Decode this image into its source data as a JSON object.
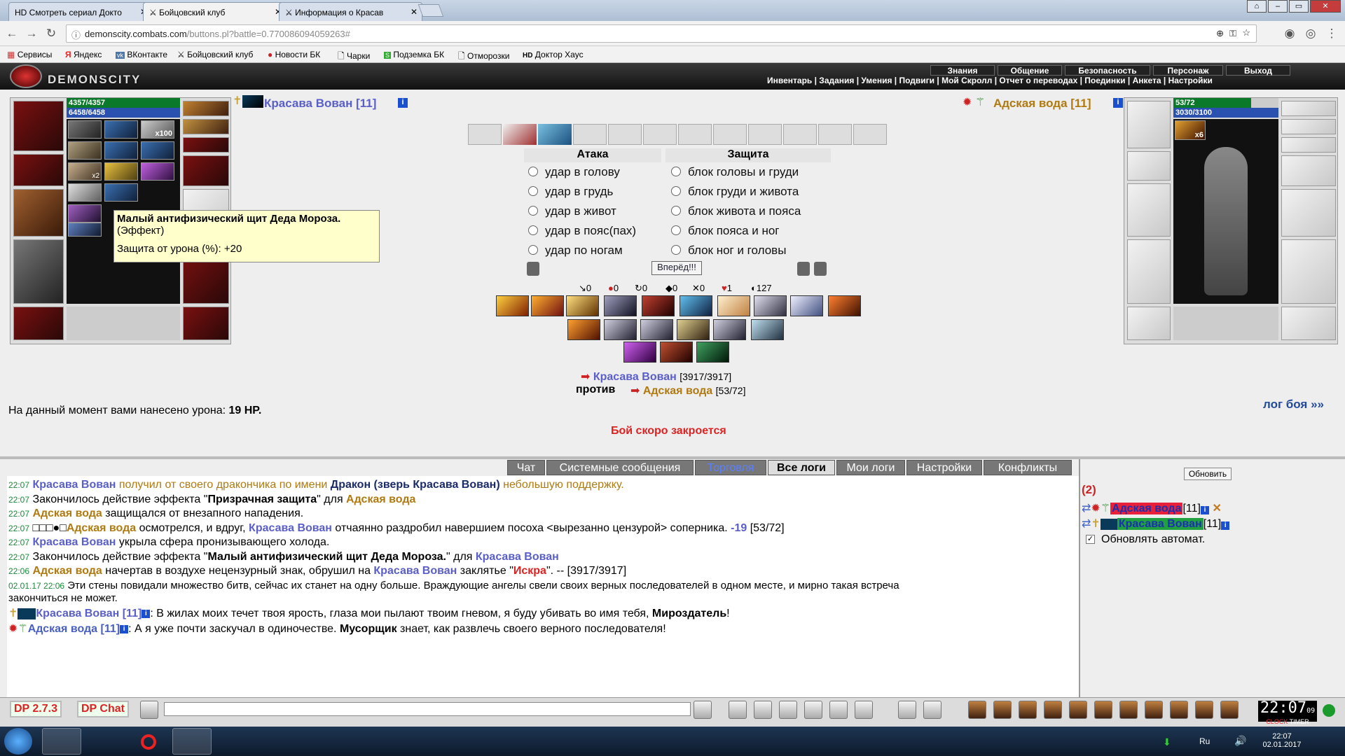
{
  "browser": {
    "tabs": [
      {
        "label": "HD Смотреть сериал Докто"
      },
      {
        "label": "Бойцовский клуб"
      },
      {
        "label": "Информация о Красав"
      }
    ],
    "url_host": "demonscity.combats.com",
    "url_path": "/buttons.pl?battle=0.770086094059263#",
    "bookmarks": [
      "Сервисы",
      "Яндекс",
      "ВКонтакте",
      "Бойцовский клуб",
      "Новости БК",
      "Чарки",
      "Подземка БК",
      "Отморозки",
      "Доктор Хаус"
    ]
  },
  "site": {
    "logo": "DEMONSCITY",
    "top_menu": [
      "Знания",
      "Общение",
      "Безопасность",
      "Персонаж",
      "Выход"
    ],
    "sub_menu": "Инвентарь | Задания | Умения | Подвиги | Мой Скролл | Отчет о переводах | Поединки | Анкета | Настройки"
  },
  "player": {
    "name": "Красава Вован [11]",
    "hp": "4357/4357",
    "mana": "6458/6458",
    "badge_x100": "x100",
    "badge_x2": "x2"
  },
  "enemy": {
    "name": "Адская вода [11]",
    "hp": "53/72",
    "mana": "3030/3100",
    "badge_x6": "x6"
  },
  "battle": {
    "attack_title": "Атака",
    "defense_title": "Защита",
    "attacks": [
      "удар в голову",
      "удар в грудь",
      "удар в живот",
      "удар в пояс(пах)",
      "удар по ногам"
    ],
    "defenses": [
      "блок головы и груди",
      "блок груди и живота",
      "блок живота и пояса",
      "блок пояса и ног",
      "блок ног и головы"
    ],
    "go_button": "Вперёд!!!",
    "counters": [
      "0",
      "0",
      "0",
      "0",
      "0",
      "1",
      "127"
    ],
    "vs_player": "Красава Вован",
    "vs_player_hp": "[3917/3917]",
    "vs_word": "против",
    "vs_enemy": "Адская вода",
    "vs_enemy_hp": "[53/72]",
    "damage_prefix": "На данный момент вами нанесено урона: ",
    "damage_value": "19 HP.",
    "closing": "Бой скоро закроется",
    "log_link": "лог боя »»"
  },
  "tooltip": {
    "title": "Малый антифизический щит Деда Мороза.",
    "sub": "(Эффект)",
    "detail": "Защита от урона (%): +20"
  },
  "chat_tabs": [
    "Чат",
    "Системные сообщения",
    "Торговля",
    "Все логи",
    "Мои логи",
    "Настройки",
    "Конфликты"
  ],
  "chat_lines": [
    {
      "t": "22:07",
      "parts": [
        {
          "s": "Красава Вован",
          "c": "blue",
          "b": true
        },
        {
          "s": " получил от своего дракончика по имени ",
          "c": "gold"
        },
        {
          "s": "Дракон (зверь Красава Вован)",
          "c": "dark",
          "b": true
        },
        {
          "s": " небольшую поддержку.",
          "c": "gold"
        }
      ]
    },
    {
      "t": "22:07",
      "parts": [
        {
          "s": "Закончилось действие эффекта \""
        },
        {
          "s": "Призрачная защита",
          "b": true
        },
        {
          "s": "\" для "
        },
        {
          "s": "Адская вода",
          "c": "gold",
          "b": true
        }
      ]
    },
    {
      "t": "22:07",
      "parts": [
        {
          "s": "Адская вода",
          "c": "gold",
          "b": true
        },
        {
          "s": " защищался от внезапного нападения."
        }
      ]
    },
    {
      "t": "22:07",
      "parts": [
        {
          "s": "□□□●□"
        },
        {
          "s": "Адская вода",
          "c": "gold",
          "b": true
        },
        {
          "s": " осмотрелся, и вдруг, "
        },
        {
          "s": "Красава Вован",
          "c": "blue",
          "b": true
        },
        {
          "s": " отчаянно раздробил навершием посоха <вырезанно цензурой> соперника. "
        },
        {
          "s": "-19",
          "c": "blue",
          "b": true
        },
        {
          "s": " [53/72]"
        }
      ]
    },
    {
      "t": "22:07",
      "parts": [
        {
          "s": "Красава Вован",
          "c": "blue",
          "b": true
        },
        {
          "s": " укрыла сфера пронизывающего холода."
        }
      ]
    },
    {
      "t": "22:07",
      "parts": [
        {
          "s": "Закончилось действие эффекта \""
        },
        {
          "s": "Малый антифизический щит Деда Мороза.",
          "b": true
        },
        {
          "s": "\" для "
        },
        {
          "s": "Красава Вован",
          "c": "blue",
          "b": true
        }
      ]
    },
    {
      "t": "22:06",
      "parts": [
        {
          "s": "Адская вода",
          "c": "gold",
          "b": true
        },
        {
          "s": " начертав в воздухе нецензурный знак, обрушил на "
        },
        {
          "s": "Красава Вован",
          "c": "blue",
          "b": true
        },
        {
          "s": " заклятье \""
        },
        {
          "s": "Искра",
          "c": "red",
          "b": true
        },
        {
          "s": "\". -- [3917/3917]"
        }
      ]
    }
  ],
  "chat_intro_time": "02.01.17 22:06",
  "chat_intro": "Эти стены повидали множество битв, сейчас их станет на одну больше. Враждующие ангелы свели своих верных последователей в одном месте, и мирно такая встреча",
  "chat_intro2": "закончиться не может.",
  "chat_quote1_name": "Красава Вован [11]",
  "chat_quote1_a": ": В жилах моих течет твоя ярость, глаза мои пылают твоим гневом, я буду убивать во имя тебя, ",
  "chat_quote1_b": "Мироздатель",
  "chat_quote1_c": "!",
  "chat_quote2_name": "Адская вода [11]",
  "chat_quote2_a": ": А я уже почти заскучал в одиночестве. ",
  "chat_quote2_b": "Мусорщик",
  "chat_quote2_c": " знает, как развлечь своего верного последователя!",
  "right_panel": {
    "refresh": "Обновить",
    "count": "(2)",
    "enemy_name": "Адская вода",
    "player_name": "Красава Вован",
    "level": "[11]",
    "auto": "Обновлять автомат."
  },
  "bottom": {
    "dp_version": "DP 2.7.3",
    "dp_chat": "DP Chat",
    "clock": "22:07",
    "clock_sec": "09",
    "clock_label": "CLOCK",
    "timer_label": "TIMER"
  },
  "taskbar": {
    "lang": "Ru",
    "time": "22:07",
    "date": "02.01.2017"
  }
}
